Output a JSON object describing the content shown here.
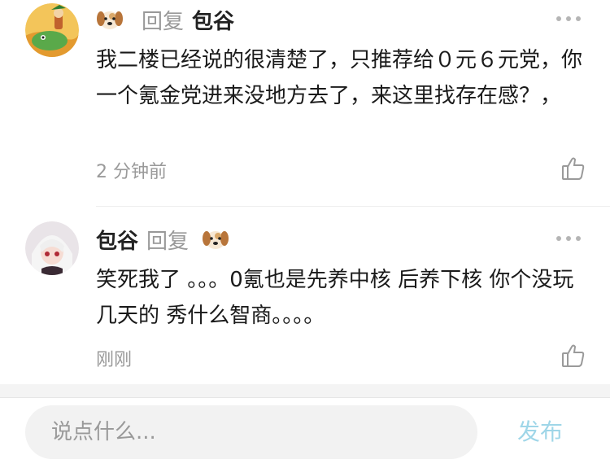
{
  "comments": [
    {
      "author": "包谷",
      "reply_word": "回复",
      "reply_to_emoji": "dog-face-icon",
      "text": "我二楼已经说的很清楚了，只推荐给０元６元党，你一个氪金党进来没地方去了，来这里找存在感？，",
      "time": "2 分钟前"
    },
    {
      "author": "包谷",
      "reply_word": "回复",
      "reply_to_emoji": "dog-face-icon",
      "text": "笑死我了 。。。0氪也是先养中核 后养下核 你个没玩几天的 秀什么智商。。。。",
      "time": "刚刚"
    }
  ],
  "composer": {
    "placeholder": "说点什么...",
    "send_label": "发布"
  },
  "colors": {
    "accent_send": "#9fd6e8",
    "secondary_text": "#999999"
  }
}
